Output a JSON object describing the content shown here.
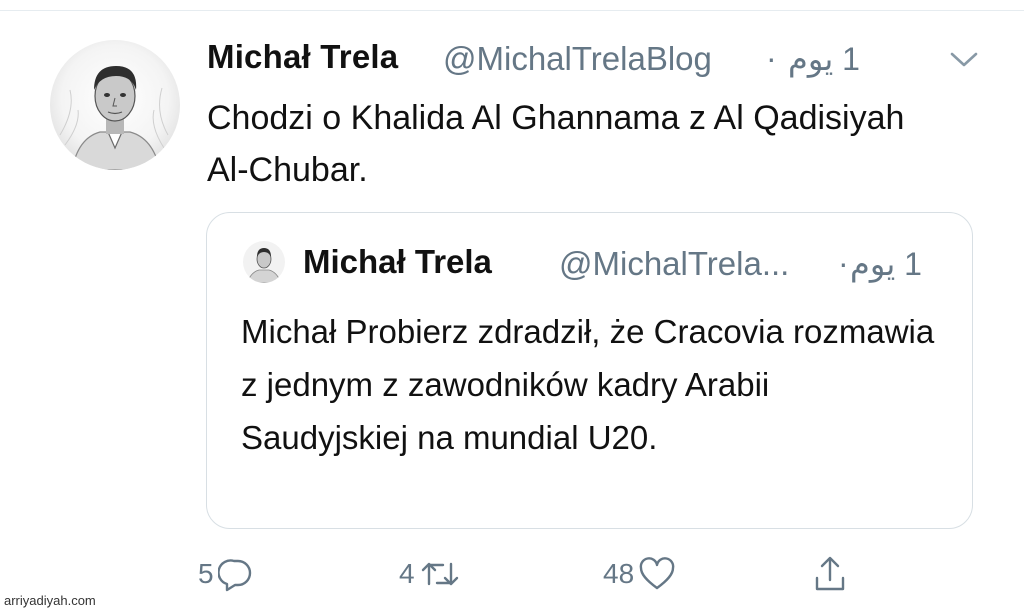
{
  "tweet": {
    "author_name": "Michał Trela",
    "handle": "@MichalTrelaBlog",
    "separator": "·",
    "time": "1 يوم",
    "text": "Chodzi o Khalida Al Ghannama z Al Qadisiyah Al-Chubar."
  },
  "quoted": {
    "author_name": "Michał Trela",
    "handle": "@MichalTrela...",
    "separator": "·",
    "time": "1 يوم",
    "text": "Michał Probierz zdradził, że Cracovia rozmawia z jednym z zawodników kadry Arabii Saudyjskiej na mundial U20."
  },
  "actions": {
    "reply_count": "5",
    "retweet_count": "4",
    "like_count": "48",
    "reply_icon": "reply-icon",
    "retweet_icon": "retweet-icon",
    "like_icon": "heart-icon",
    "share_icon": "share-icon"
  },
  "watermark": "arriyadiyah.com",
  "colors": {
    "text": "#111111",
    "secondary": "#657786",
    "border": "#d8dfe4"
  }
}
